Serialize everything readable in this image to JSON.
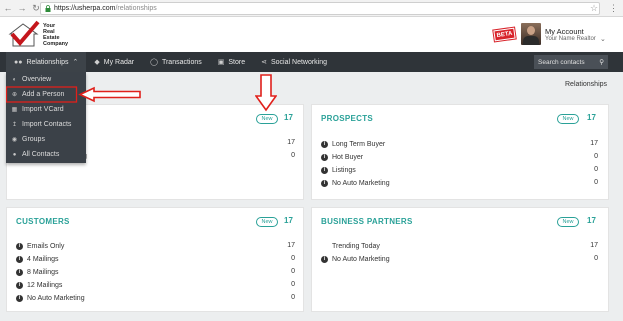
{
  "browser": {
    "url_host": "https://usherpa.com",
    "url_path": "/relationships"
  },
  "header": {
    "logo_lines": [
      "Your",
      "Real Estate",
      "Company"
    ],
    "beta_label": "BETA",
    "account_title": "My Account",
    "account_subtitle": "Your Name Realtor"
  },
  "nav": {
    "items": [
      {
        "label": "Relationships",
        "icon": "users-icon"
      },
      {
        "label": "My Radar",
        "icon": "bell-icon"
      },
      {
        "label": "Transactions",
        "icon": "dollar-icon"
      },
      {
        "label": "Store",
        "icon": "cart-icon"
      },
      {
        "label": "Social Networking",
        "icon": "share-icon"
      }
    ],
    "search_placeholder": "Search contacts"
  },
  "dropdown": {
    "items": [
      {
        "label": "Overview"
      },
      {
        "label": "Add a Person"
      },
      {
        "label": "Import VCard"
      },
      {
        "label": "Import Contacts"
      },
      {
        "label": "Groups"
      },
      {
        "label": "All Contacts"
      }
    ]
  },
  "breadcrumb": "Relationships",
  "cards": {
    "first": {
      "new_label": "New",
      "count": "17",
      "rows": [
        {
          "label": "",
          "value": "17"
        },
        {
          "label": "g",
          "value": "0"
        }
      ]
    },
    "prospects": {
      "title": "PROSPECTS",
      "new_label": "New",
      "count": "17",
      "rows": [
        {
          "label": "Long Term Buyer",
          "value": "17"
        },
        {
          "label": "Hot Buyer",
          "value": "0"
        },
        {
          "label": "Listings",
          "value": "0"
        },
        {
          "label": "No Auto Marketing",
          "value": "0"
        }
      ]
    },
    "customers": {
      "title": "CUSTOMERS",
      "new_label": "New",
      "count": "17",
      "rows": [
        {
          "label": "Emails Only",
          "value": "17"
        },
        {
          "label": "4 Mailings",
          "value": "0"
        },
        {
          "label": "8 Mailings",
          "value": "0"
        },
        {
          "label": "12 Mailings",
          "value": "0"
        },
        {
          "label": "No Auto Marketing",
          "value": "0"
        }
      ]
    },
    "partners": {
      "title": "BUSINESS PARTNERS",
      "new_label": "New",
      "count": "17",
      "rows": [
        {
          "label": "Trending Today",
          "value": "17"
        },
        {
          "label": "No Auto Marketing",
          "value": "0"
        }
      ]
    }
  },
  "colors": {
    "accent": "#2aa198",
    "navbar": "#2f3439",
    "annotation_red": "#e0201b"
  }
}
